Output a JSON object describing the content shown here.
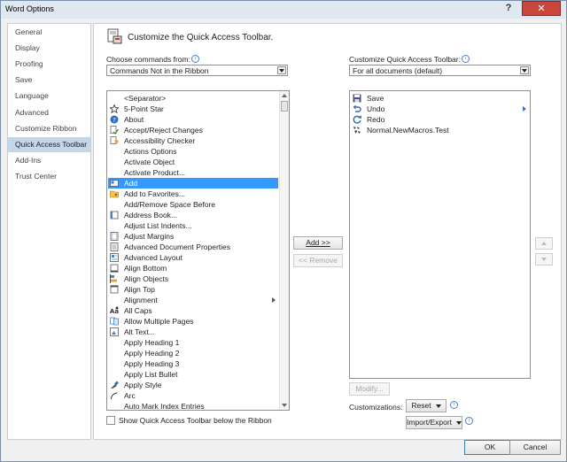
{
  "window": {
    "title": "Word Options",
    "help_label": "?",
    "close_label": "✕"
  },
  "nav": {
    "items": [
      {
        "label": "General",
        "selected": false
      },
      {
        "label": "Display",
        "selected": false
      },
      {
        "label": "Proofing",
        "selected": false
      },
      {
        "label": "Save",
        "selected": false
      },
      {
        "label": "Language",
        "selected": false
      },
      {
        "label": "Advanced",
        "selected": false
      },
      {
        "label": "Customize Ribbon",
        "selected": false
      },
      {
        "label": "Quick Access Toolbar",
        "selected": true
      },
      {
        "label": "Add-Ins",
        "selected": false
      },
      {
        "label": "Trust Center",
        "selected": false
      }
    ]
  },
  "header": {
    "title": "Customize the Quick Access Toolbar.",
    "icon": "toolbar-customize-icon"
  },
  "left": {
    "label": "Choose commands from:",
    "combo_value": "Commands Not in the Ribbon",
    "commands": [
      {
        "label": "<Separator>",
        "icon": "",
        "selected": false,
        "submenu": false
      },
      {
        "label": "5-Point Star",
        "icon": "star",
        "selected": false,
        "submenu": false
      },
      {
        "label": "About",
        "icon": "help",
        "selected": false,
        "submenu": false
      },
      {
        "label": "Accept/Reject Changes",
        "icon": "doc-check",
        "selected": false,
        "submenu": false
      },
      {
        "label": "Accessibility Checker",
        "icon": "doc-person",
        "selected": false,
        "submenu": false
      },
      {
        "label": "Actions Options",
        "icon": "",
        "selected": false,
        "submenu": false
      },
      {
        "label": "Activate Object",
        "icon": "",
        "selected": false,
        "submenu": false
      },
      {
        "label": "Activate Product...",
        "icon": "",
        "selected": false,
        "submenu": false
      },
      {
        "label": "Add",
        "icon": "card",
        "selected": true,
        "submenu": false
      },
      {
        "label": "Add to Favorites...",
        "icon": "folder-star",
        "selected": false,
        "submenu": false
      },
      {
        "label": "Add/Remove Space Before",
        "icon": "",
        "selected": false,
        "submenu": false
      },
      {
        "label": "Address Book...",
        "icon": "book",
        "selected": false,
        "submenu": false
      },
      {
        "label": "Adjust List Indents...",
        "icon": "",
        "selected": false,
        "submenu": false
      },
      {
        "label": "Adjust Margins",
        "icon": "page",
        "selected": false,
        "submenu": false
      },
      {
        "label": "Advanced Document Properties",
        "icon": "doc-props",
        "selected": false,
        "submenu": false
      },
      {
        "label": "Advanced Layout",
        "icon": "layout",
        "selected": false,
        "submenu": false
      },
      {
        "label": "Align Bottom",
        "icon": "align-bottom",
        "selected": false,
        "submenu": false
      },
      {
        "label": "Align Objects",
        "icon": "align-objects",
        "selected": false,
        "submenu": false
      },
      {
        "label": "Align Top",
        "icon": "align-top",
        "selected": false,
        "submenu": false
      },
      {
        "label": "Alignment",
        "icon": "",
        "selected": false,
        "submenu": true
      },
      {
        "label": "All Caps",
        "icon": "caps",
        "selected": false,
        "submenu": false
      },
      {
        "label": "Allow Multiple Pages",
        "icon": "pages",
        "selected": false,
        "submenu": false
      },
      {
        "label": "Alt Text...",
        "icon": "alt-text",
        "selected": false,
        "submenu": false
      },
      {
        "label": "Apply Heading 1",
        "icon": "",
        "selected": false,
        "submenu": false
      },
      {
        "label": "Apply Heading 2",
        "icon": "",
        "selected": false,
        "submenu": false
      },
      {
        "label": "Apply Heading 3",
        "icon": "",
        "selected": false,
        "submenu": false
      },
      {
        "label": "Apply List Bullet",
        "icon": "",
        "selected": false,
        "submenu": false
      },
      {
        "label": "Apply Style",
        "icon": "style",
        "selected": false,
        "submenu": false
      },
      {
        "label": "Arc",
        "icon": "arc",
        "selected": false,
        "submenu": false
      },
      {
        "label": "Auto Mark Index Entries",
        "icon": "",
        "selected": false,
        "submenu": false
      }
    ]
  },
  "middle": {
    "add_label": "Add >>",
    "remove_label": "<< Remove"
  },
  "right": {
    "label": "Customize Quick Access Toolbar:",
    "combo_value": "For all documents (default)",
    "items": [
      {
        "label": "Save",
        "icon": "save",
        "submenu": false
      },
      {
        "label": "Undo",
        "icon": "undo",
        "submenu": true
      },
      {
        "label": "Redo",
        "icon": "redo",
        "submenu": false
      },
      {
        "label": "Normal.NewMacros.Test",
        "icon": "macro",
        "submenu": false
      }
    ],
    "modify_label": "Modify...",
    "customizations_label": "Customizations:",
    "reset_label": "Reset",
    "import_export_label": "Import/Export"
  },
  "show_below_ribbon_label": "Show Quick Access Toolbar below the Ribbon",
  "show_below_ribbon_checked": false,
  "footer": {
    "ok_label": "OK",
    "cancel_label": "Cancel"
  },
  "colors": {
    "selection": "#3399ff",
    "nav_selected": "#c5d5ea",
    "close_button": "#c9463d"
  }
}
